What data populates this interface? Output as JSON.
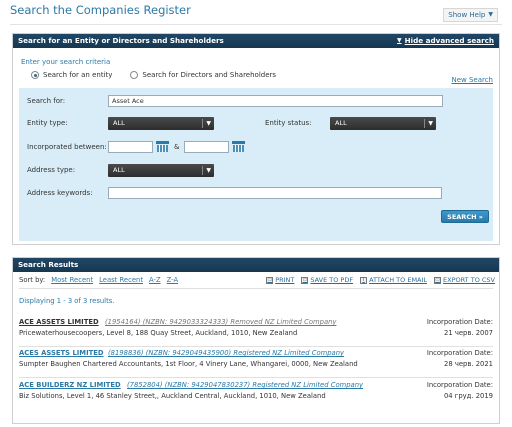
{
  "header": {
    "title": "Search the Companies Register",
    "show_help": "Show Help"
  },
  "search_panel": {
    "title": "Search for an Entity or Directors and Shareholders",
    "hide_advanced": "Hide advanced search",
    "criteria_label": "Enter your search criteria",
    "radio_entity": "Search for an entity",
    "radio_directors": "Search for Directors and Shareholders",
    "new_search": "New Search",
    "fields": {
      "search_for_label": "Search for:",
      "search_for_value": "Asset Ace",
      "entity_type_label": "Entity type:",
      "entity_type_value": "ALL",
      "entity_status_label": "Entity status:",
      "entity_status_value": "ALL",
      "incorporated_label": "Incorporated between:",
      "incorporated_from": "",
      "incorporated_to": "",
      "amp": "&",
      "address_type_label": "Address type:",
      "address_type_value": "ALL",
      "address_keywords_label": "Address keywords:",
      "address_keywords_value": ""
    },
    "search_button": "SEARCH »"
  },
  "results_panel": {
    "title": "Search Results",
    "sort_label": "Sort by:",
    "sort_options": [
      "Most Recent",
      "Least Recent",
      "A-Z",
      "Z-A"
    ],
    "tools": {
      "print": "PRINT",
      "save_pdf": "SAVE TO PDF",
      "attach_email": "ATTACH TO EMAIL",
      "export_csv": "EXPORT TO CSV"
    },
    "displaying": "Displaying 1 - 3 of 3 results.",
    "results": [
      {
        "name": "ACE ASSETS LIMITED",
        "detail": "(1954164) (NZBN: 9429033324333) Removed NZ Limited Company",
        "address": "Pricewaterhousecoopers, Level 8, 188 Quay Street, Auckland, 1010, New Zealand",
        "date_label": "Incorporation Date:",
        "date": "21 черв. 2007"
      },
      {
        "name": "ACES ASSETS LIMITED",
        "detail": "(8198836) (NZBN: 9429049435900) Registered NZ Limited Company",
        "address": "Sumpter Baughen Chartered Accountants, 1st Floor, 4 Vinery Lane, Whangarei, 0000, New Zealand",
        "date_label": "Incorporation Date:",
        "date": "28 черв. 2021"
      },
      {
        "name": "ACE BUILDERZ NZ LIMITED",
        "detail": "(7852804) (NZBN: 9429047830237) Registered NZ Limited Company",
        "address": "Biz Solutions, Level 1, 46 Stanley Street,, Auckland Central, Auckland, 1010, New Zealand",
        "date_label": "Incorporation Date:",
        "date": "04 груд. 2019"
      }
    ]
  },
  "colors": {
    "accent": "#2a7aa8",
    "panel_header": "#1c3f5c",
    "form_background": "#d8edf7"
  }
}
